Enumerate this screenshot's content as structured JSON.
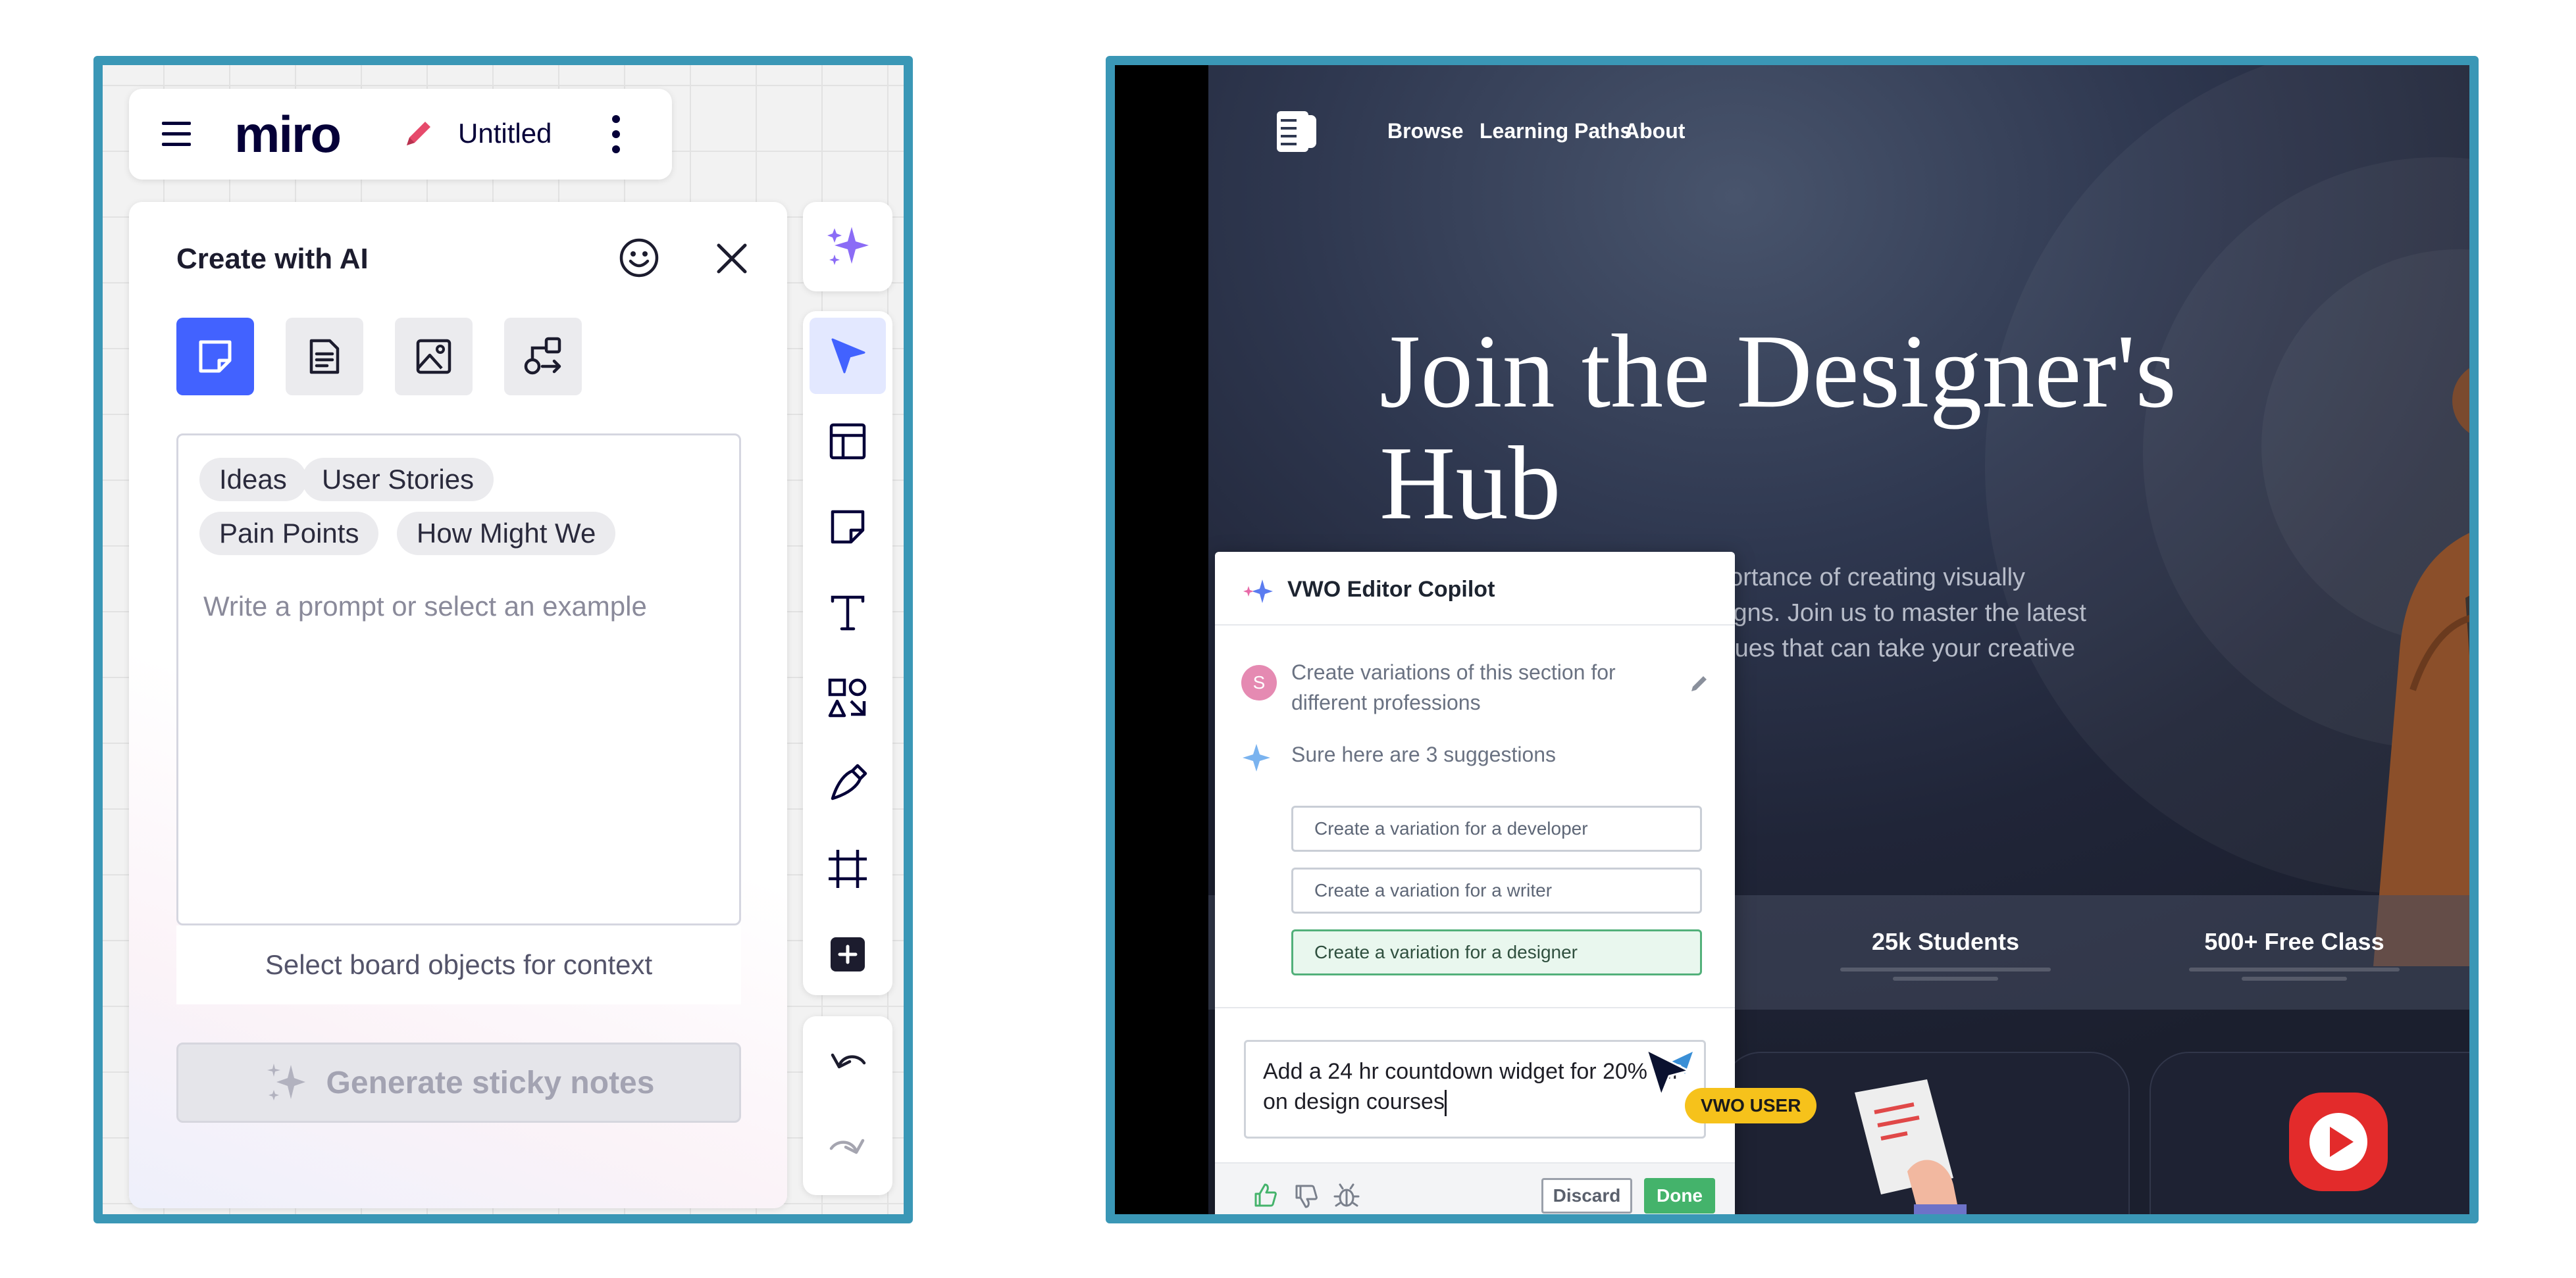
{
  "miro": {
    "logo_text": "miro",
    "board_title": "Untitled",
    "ai_panel": {
      "title": "Create with AI",
      "modes": [
        "sticky-notes",
        "document",
        "image",
        "diagram"
      ],
      "selected_mode": "sticky-notes",
      "chips": [
        "Ideas",
        "User Stories",
        "Pain Points",
        "How Might We"
      ],
      "prompt_placeholder": "Write a prompt or select an example",
      "context_label": "Select board objects for context",
      "generate_label": "Generate sticky notes"
    },
    "toolbar": {
      "tools": [
        "select-icon",
        "templates-icon",
        "sticky-note-icon",
        "text-icon",
        "shapes-icon",
        "pen-icon",
        "frame-icon",
        "add-icon"
      ],
      "active_tool": "select-icon",
      "history": [
        "undo-icon",
        "redo-icon"
      ]
    },
    "colors": {
      "accent": "#4262ff",
      "frame_border": "#3a97b6",
      "ai_sparkle": "#8b6cf6"
    }
  },
  "site": {
    "nav": [
      "Browse",
      "Learning Paths",
      "About"
    ],
    "hero_title": "Join the Designer's Hub",
    "hero_desc_lines": [
      "portance of creating visually",
      "signs. Join us to master the latest",
      "iques that can take your creative"
    ],
    "stats": [
      "25k Students",
      "500+ Free Class"
    ]
  },
  "vwo": {
    "title": "VWO Editor Copilot",
    "user_avatar_letter": "S",
    "user_message": "Create variations of this section for different professions",
    "bot_message": "Sure here are 3 suggestions",
    "suggestions": [
      "Create a variation for a developer",
      "Create a variation for a writer",
      "Create a variation for a designer"
    ],
    "selected_suggestion": 2,
    "input_value": "Add a 24 hr countdown widget for 20% off on design courses",
    "discard_label": "Discard",
    "done_label": "Done",
    "cursor_badge": "VWO USER",
    "colors": {
      "done": "#44b36b",
      "badge": "#f6c21b",
      "avatar": "#e58ab2"
    }
  }
}
